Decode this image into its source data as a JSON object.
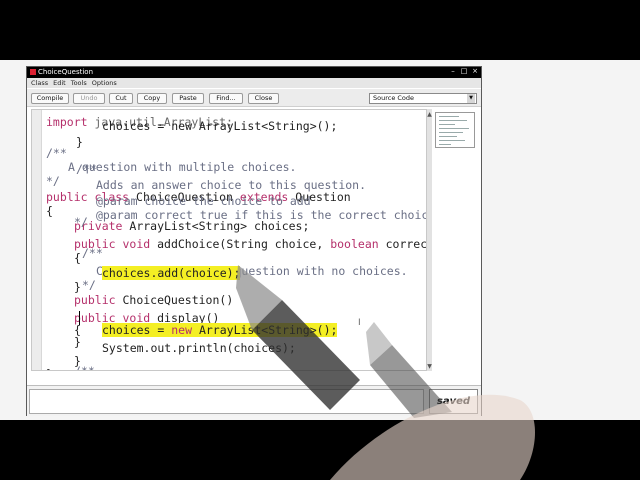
{
  "window": {
    "title": "ChoiceQuestion"
  },
  "menu": {
    "items": [
      "Class",
      "Edit",
      "Tools",
      "Options"
    ]
  },
  "toolbar": {
    "buttons": [
      {
        "label": "Compile",
        "enabled": true
      },
      {
        "label": "Undo",
        "enabled": false
      },
      {
        "label": "Cut",
        "enabled": true
      },
      {
        "label": "Copy",
        "enabled": true
      },
      {
        "label": "Paste",
        "enabled": true
      },
      {
        "label": "Find...",
        "enabled": true
      },
      {
        "label": "Close",
        "enabled": true
      }
    ],
    "view_selector": "Source Code"
  },
  "code": {
    "lines": [
      "import java.util.ArrayList;",
      "choices = new ArrayList<String>();",
      "}",
      "/**",
      "A question with multiple choices.",
      "/**",
      "*/",
      "Adds an answer choice to this question.",
      "public class ChoiceQuestion extends Question",
      "@param choice the choice to add",
      "{",
      "@param correct true if this is the correct choice",
      "private ArrayList<String> choices;",
      "*/",
      "public void addChoice(String choice, boolean correct)",
      "{",
      "/**",
      "Constructs a choice question with no choices.",
      "choices.add(choice);",
      "*/",
      "}",
      "public ChoiceQuestion()",
      "public void display()",
      "{",
      "choices = new ArrayList<String>();",
      "}",
      "System.out.println(choices);",
      "}",
      "}",
      "/**"
    ]
  },
  "status": {
    "saved_label": "saved"
  },
  "colors": {
    "highlight": "#f4ef24",
    "keyword": "#b5306b",
    "comment": "#6a6f85"
  }
}
